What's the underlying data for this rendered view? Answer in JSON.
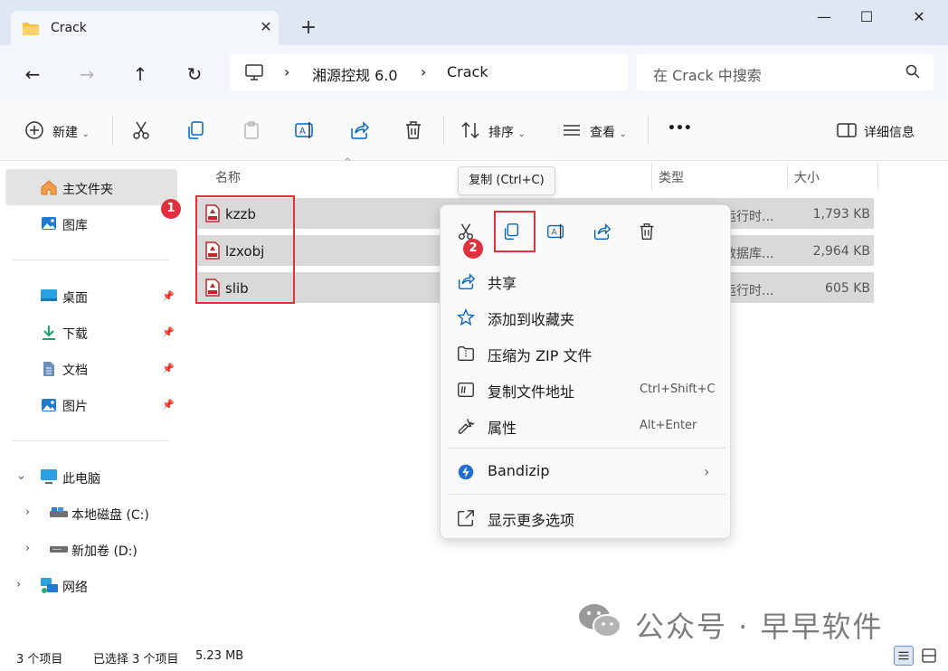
{
  "window": {
    "tab_title": "Crack",
    "tab_close": "✕",
    "new_tab": "+",
    "minimize": "—",
    "maximize": "☐",
    "close": "✕"
  },
  "address": {
    "crumbs": [
      "湘源控规 6.0",
      "Crack"
    ],
    "separator": "›",
    "search_placeholder": "在 Crack 中搜索"
  },
  "toolbar": {
    "new_label": "新建",
    "sort_label": "排序",
    "view_label": "查看",
    "more_label": "•••",
    "details_label": "详细信息"
  },
  "nav": {
    "home": "主文件夹",
    "gallery": "图库",
    "quick": [
      "桌面",
      "下载",
      "文档",
      "图片"
    ],
    "this_pc": "此电脑",
    "drives": [
      "本地磁盘 (C:)",
      "新加卷 (D:)"
    ],
    "network": "网络"
  },
  "columns": {
    "name": "名称",
    "type": "类型",
    "size": "大小"
  },
  "files": [
    {
      "name": "kzzb",
      "type": "运行时...",
      "size": "1,793 KB"
    },
    {
      "name": "lzxobj",
      "type": "数据库...",
      "size": "2,964 KB"
    },
    {
      "name": "slib",
      "type": "运行时...",
      "size": "605 KB"
    }
  ],
  "tooltip": "复制 (Ctrl+C)",
  "badges": [
    "1",
    "2"
  ],
  "context_menu": {
    "items": [
      {
        "label": "共享",
        "shortcut": ""
      },
      {
        "label": "添加到收藏夹",
        "shortcut": ""
      },
      {
        "label": "压缩为 ZIP 文件",
        "shortcut": ""
      },
      {
        "label": "复制文件地址",
        "shortcut": "Ctrl+Shift+C"
      },
      {
        "label": "属性",
        "shortcut": "Alt+Enter"
      },
      {
        "label": "Bandizip",
        "shortcut": ""
      },
      {
        "label": "显示更多选项",
        "shortcut": ""
      }
    ]
  },
  "status": {
    "count": "3 个项目",
    "selected": "已选择 3 个项目",
    "size": "5.23 MB"
  },
  "watermark": "公众号 · 早早软件",
  "colors": {
    "accent": "#0067c0",
    "highlight_red": "#e0323c",
    "selection_gray": "#d9d9d9",
    "folder_yellow": "#f5c342"
  }
}
